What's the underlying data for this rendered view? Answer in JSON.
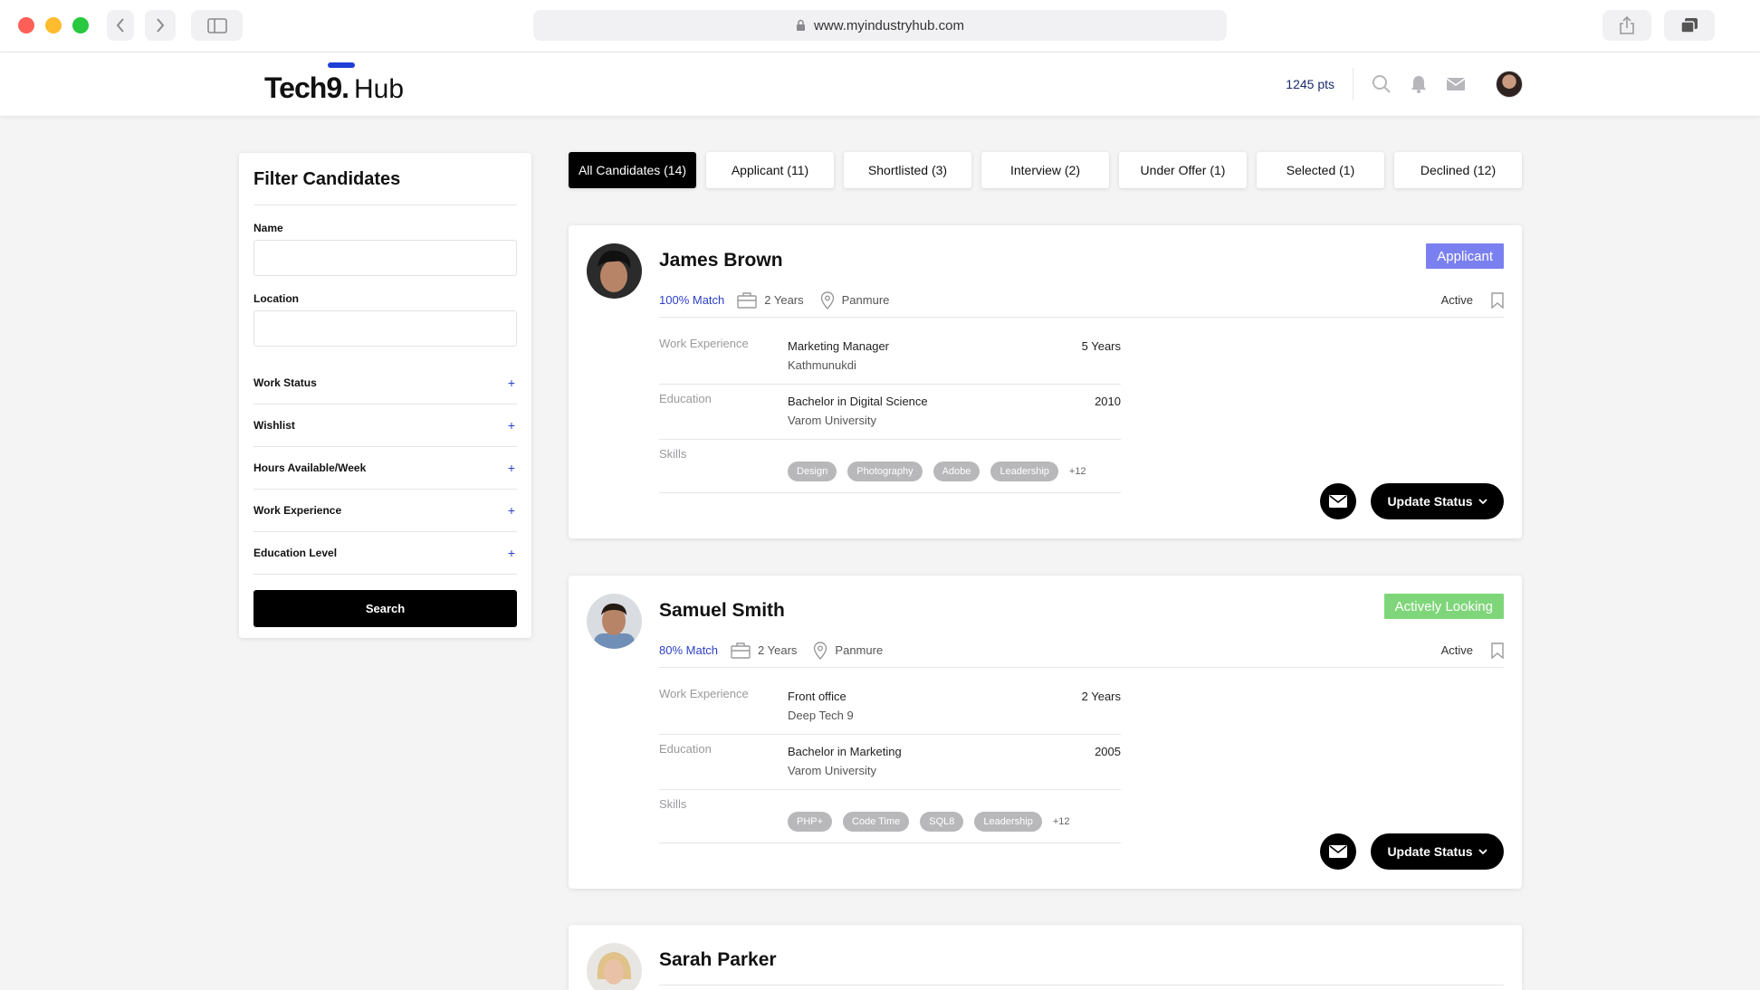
{
  "browser": {
    "url": "www.myindustryhub.com"
  },
  "header": {
    "logo_main": "Tech9.",
    "logo_hub": "Hub",
    "points": "1245 pts",
    "icons": [
      "search-icon",
      "bell-icon",
      "mail-icon"
    ]
  },
  "filter": {
    "title": "Filter Candidates",
    "name_label": "Name",
    "name_value": "",
    "location_label": "Location",
    "location_value": "",
    "sections": [
      "Work Status",
      "Wishlist",
      "Hours Available/Week",
      "Work Experience",
      "Education Level"
    ],
    "search_label": "Search"
  },
  "tabs": [
    {
      "label": "All Candidates (14)",
      "active": true
    },
    {
      "label": "Applicant (11)",
      "active": false
    },
    {
      "label": "Shortlisted (3)",
      "active": false
    },
    {
      "label": "Interview (2)",
      "active": false
    },
    {
      "label": "Under Offer (1)",
      "active": false
    },
    {
      "label": "Selected (1)",
      "active": false
    },
    {
      "label": "Declined (12)",
      "active": false
    }
  ],
  "labels": {
    "work_experience": "Work Experience",
    "education": "Education",
    "skills": "Skills",
    "update_status": "Update Status"
  },
  "candidates": [
    {
      "name": "James Brown",
      "badge": "Applicant",
      "badge_color": "#7b80f0",
      "match": "100% Match",
      "experience": "2 Years",
      "location": "Panmure",
      "status": "Active",
      "work": {
        "title": "Marketing Manager",
        "company": "Kathmunukdi",
        "duration": "5 Years"
      },
      "education": {
        "degree": "Bachelor in Digital Science",
        "school": "Varom University",
        "year": "2010"
      },
      "skills": [
        "Design",
        "Photography",
        "Adobe",
        "Leadership"
      ],
      "more_skills": "+12"
    },
    {
      "name": "Samuel Smith",
      "badge": "Actively Looking",
      "badge_color": "#7fd67a",
      "match": "80% Match",
      "experience": "2 Years",
      "location": "Panmure",
      "status": "Active",
      "work": {
        "title": "Front office",
        "company": "Deep Tech 9",
        "duration": "2 Years"
      },
      "education": {
        "degree": "Bachelor in Marketing",
        "school": "Varom University",
        "year": "2005"
      },
      "skills": [
        "PHP+",
        "Code Time",
        "SQL8",
        "Leadership"
      ],
      "more_skills": "+12"
    },
    {
      "name": "Sarah Parker"
    }
  ]
}
